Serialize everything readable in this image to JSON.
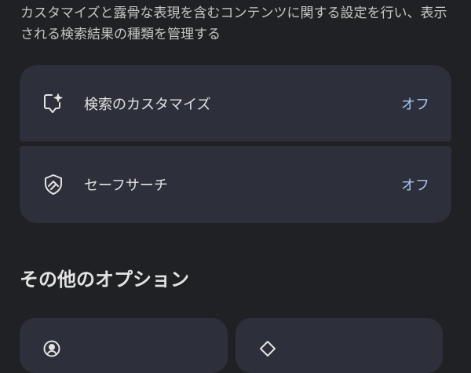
{
  "description": "カスタマイズと露骨な表現を含むコンテンツに関する設定を行い、表示される検索結果の種類を管理する",
  "settings": [
    {
      "label": "検索のカスタマイズ",
      "value": "オフ",
      "icon": "sparkle-bubble-icon"
    },
    {
      "label": "セーフサーチ",
      "value": "オフ",
      "icon": "shield-icon"
    }
  ],
  "other_options": {
    "title": "その他のオプション",
    "tiles": [
      {
        "icon": "account-circle-icon"
      },
      {
        "icon": "diamond-icon"
      }
    ]
  },
  "colors": {
    "background": "#202124",
    "card": "#2d303a",
    "accent": "#a8c7fa"
  }
}
